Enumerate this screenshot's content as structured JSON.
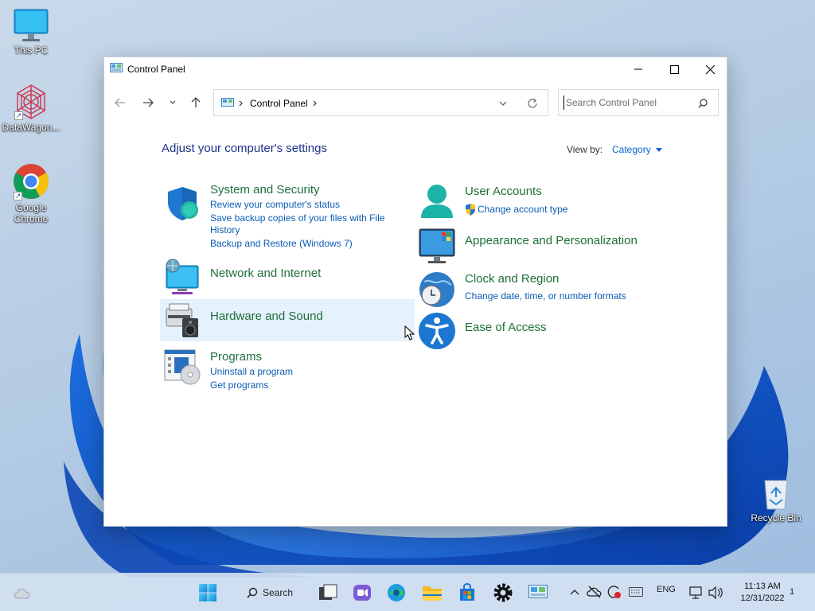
{
  "desktop": {
    "icons": [
      {
        "label": "This PC"
      },
      {
        "label": "DataWagon..."
      },
      {
        "label": "Google Chrome"
      },
      {
        "label": "Recycle Bin"
      }
    ]
  },
  "window": {
    "title": "Control Panel",
    "controls": {
      "minimize": "minimize-icon",
      "maximize": "maximize-icon",
      "close": "close-icon"
    },
    "address": {
      "crumb": "Control Panel"
    },
    "search": {
      "placeholder": "Search Control Panel"
    }
  },
  "content": {
    "heading": "Adjust your computer's settings",
    "view_by_label": "View by:",
    "view_by_value": "Category",
    "left_categories": [
      {
        "title": "System and Security",
        "links": [
          "Review your computer's status",
          "Save backup copies of your files with File",
          "History",
          "Backup and Restore (Windows 7)"
        ]
      },
      {
        "title": "Network and Internet",
        "links": []
      },
      {
        "title": "Hardware and Sound",
        "links": []
      },
      {
        "title": "Programs",
        "links": [
          "Uninstall a program",
          "Get programs"
        ]
      }
    ],
    "right_categories": [
      {
        "title": "User Accounts",
        "links": [
          "Change account type"
        ]
      },
      {
        "title": "Appearance and Personalization",
        "links": []
      },
      {
        "title": "Clock and Region",
        "links": [
          "Change date, time, or number formats"
        ]
      },
      {
        "title": "Ease of Access",
        "links": []
      }
    ]
  },
  "taskbar": {
    "search_label": "Search",
    "lang": "ENG",
    "time": "11:13 AM",
    "date": "12/31/2022",
    "notification_count": "1"
  },
  "colors": {
    "accent": "#0b5cb5",
    "category_title": "#1e6e3c",
    "heading": "#1e3287",
    "hover": "#e5f1fb"
  }
}
